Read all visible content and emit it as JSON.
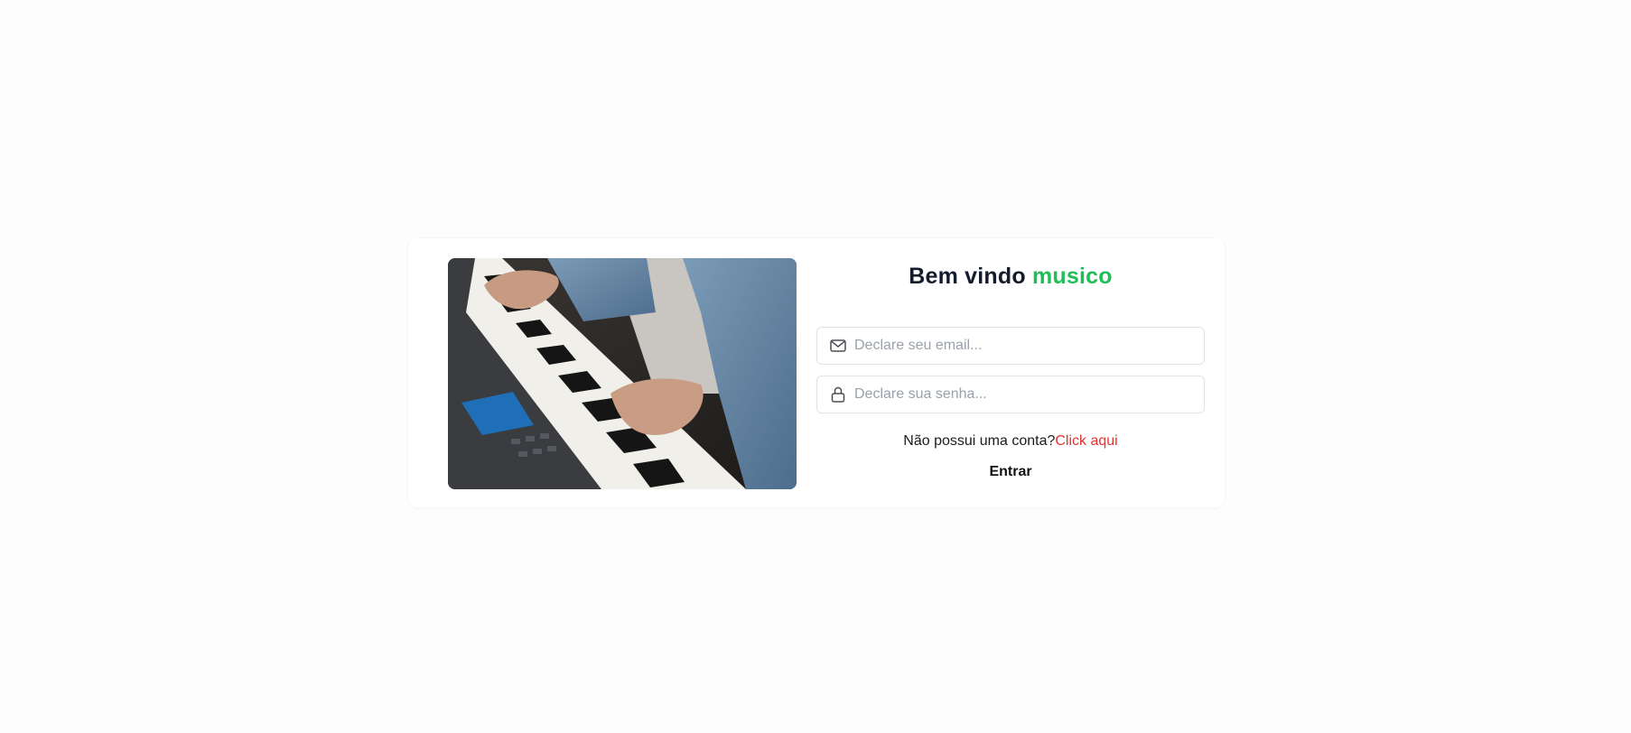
{
  "login": {
    "title_main": "Bem vindo ",
    "title_accent": "musico",
    "email_placeholder": "Declare seu email...",
    "password_placeholder": "Declare sua senha...",
    "signup_prompt": "Não possui uma conta?",
    "signup_link": "Click aqui",
    "submit_label": "Entrar"
  },
  "icons": {
    "email": "mail-icon",
    "password": "lock-icon"
  },
  "colors": {
    "accent": "#1fbe58",
    "link": "#e5322b",
    "title": "#141b2b"
  }
}
